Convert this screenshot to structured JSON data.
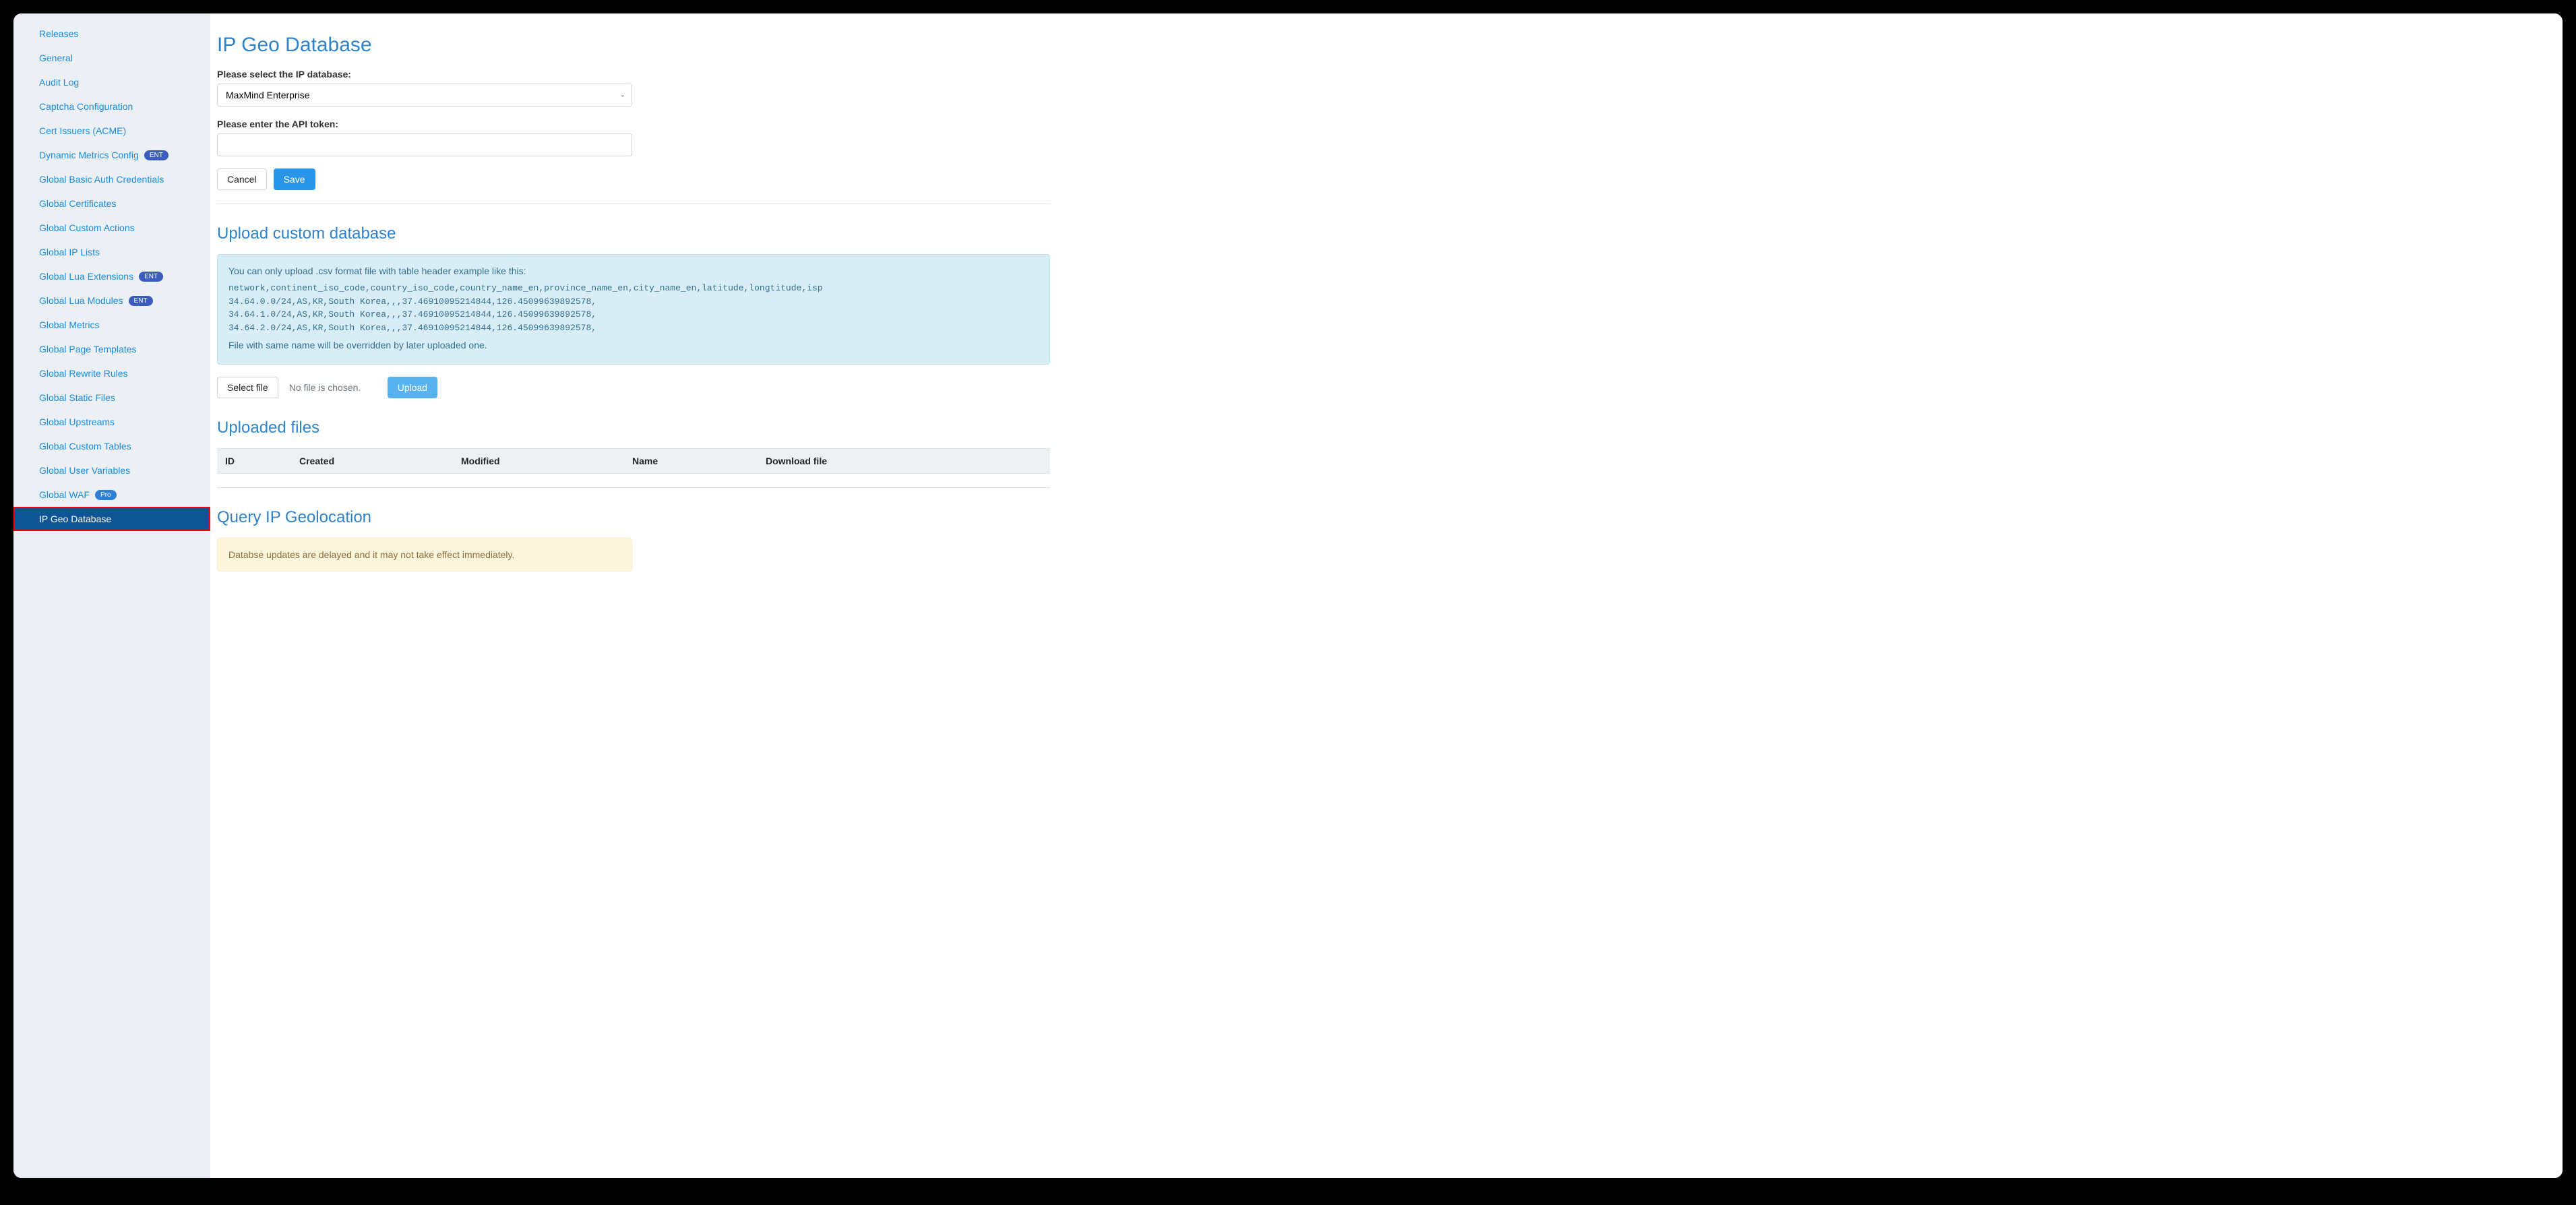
{
  "sidebar": {
    "items": [
      {
        "label": "Releases",
        "badge": null,
        "active": false
      },
      {
        "label": "General",
        "badge": null,
        "active": false
      },
      {
        "label": "Audit Log",
        "badge": null,
        "active": false
      },
      {
        "label": "Captcha Configuration",
        "badge": null,
        "active": false
      },
      {
        "label": "Cert Issuers (ACME)",
        "badge": null,
        "active": false
      },
      {
        "label": "Dynamic Metrics Config",
        "badge": "ENT",
        "active": false
      },
      {
        "label": "Global Basic Auth Credentials",
        "badge": null,
        "active": false
      },
      {
        "label": "Global Certificates",
        "badge": null,
        "active": false
      },
      {
        "label": "Global Custom Actions",
        "badge": null,
        "active": false
      },
      {
        "label": "Global IP Lists",
        "badge": null,
        "active": false
      },
      {
        "label": "Global Lua Extensions",
        "badge": "ENT",
        "active": false
      },
      {
        "label": "Global Lua Modules",
        "badge": "ENT",
        "active": false
      },
      {
        "label": "Global Metrics",
        "badge": null,
        "active": false
      },
      {
        "label": "Global Page Templates",
        "badge": null,
        "active": false
      },
      {
        "label": "Global Rewrite Rules",
        "badge": null,
        "active": false
      },
      {
        "label": "Global Static Files",
        "badge": null,
        "active": false
      },
      {
        "label": "Global Upstreams",
        "badge": null,
        "active": false
      },
      {
        "label": "Global Custom Tables",
        "badge": null,
        "active": false
      },
      {
        "label": "Global User Variables",
        "badge": null,
        "active": false
      },
      {
        "label": "Global WAF",
        "badge": "Pro",
        "active": false
      },
      {
        "label": "IP Geo Database",
        "badge": null,
        "active": true
      }
    ]
  },
  "page": {
    "title": "IP Geo Database",
    "db_select_label": "Please select the IP database:",
    "db_select_value": "MaxMind Enterprise",
    "token_label": "Please enter the API token:",
    "token_value": "",
    "cancel_label": "Cancel",
    "save_label": "Save"
  },
  "upload": {
    "heading": "Upload custom database",
    "alert_intro": "You can only upload .csv format file with table header example like this:",
    "alert_mono": "network,continent_iso_code,country_iso_code,country_name_en,province_name_en,city_name_en,latitude,longtitude,isp\n34.64.0.0/24,AS,KR,South Korea,,,37.46910095214844,126.45099639892578,\n34.64.1.0/24,AS,KR,South Korea,,,37.46910095214844,126.45099639892578,\n34.64.2.0/24,AS,KR,South Korea,,,37.46910095214844,126.45099639892578,",
    "alert_override": "File with same name will be overridden by later uploaded one.",
    "select_file_label": "Select file",
    "no_file_hint": "No file is chosen.",
    "upload_label": "Upload"
  },
  "uploaded": {
    "heading": "Uploaded files",
    "columns": [
      "ID",
      "Created",
      "Modified",
      "Name",
      "Download file"
    ]
  },
  "query": {
    "heading": "Query IP Geolocation",
    "warn": "Databse updates are delayed and it may not take effect immediately."
  }
}
